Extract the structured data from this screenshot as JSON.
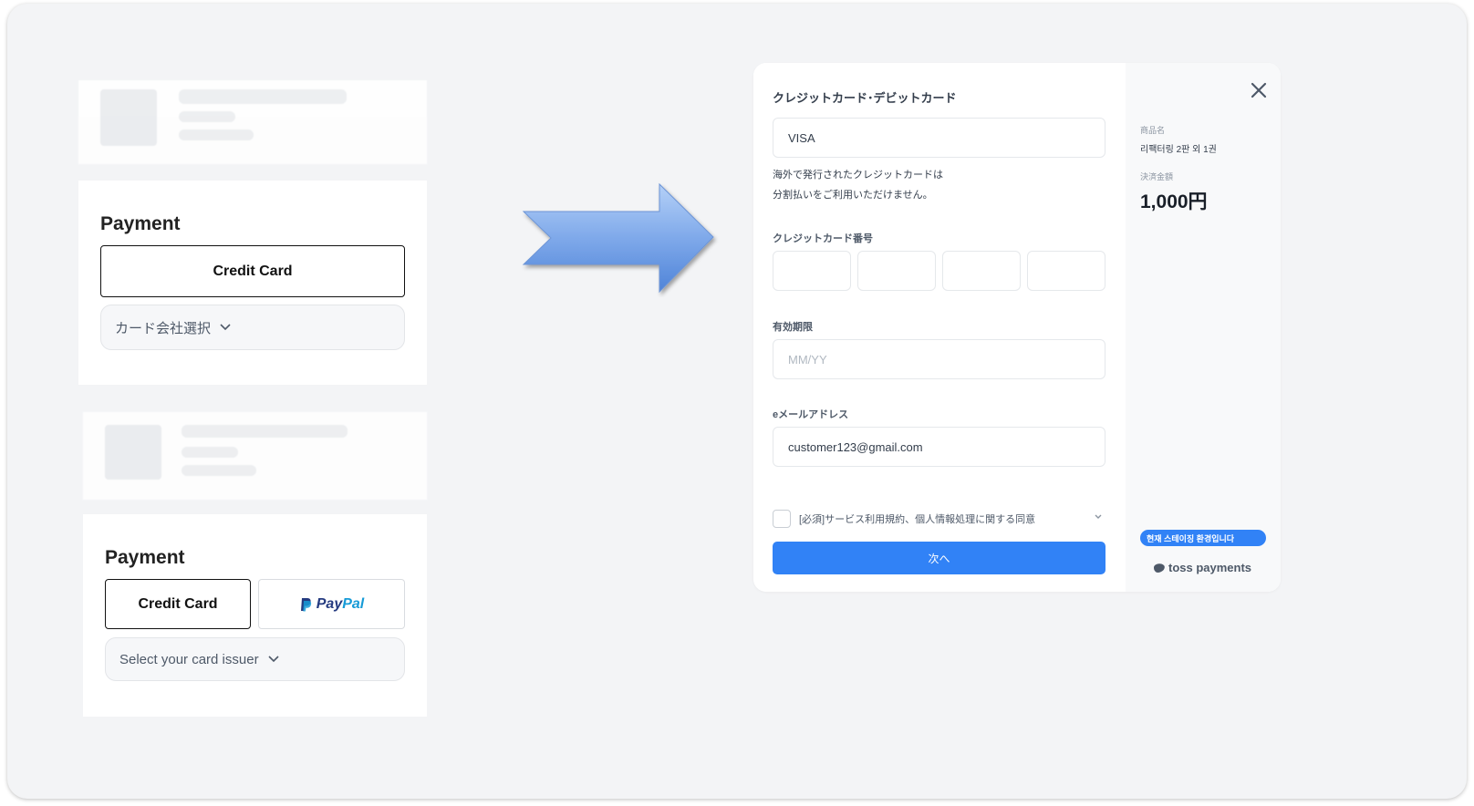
{
  "before_upper": {
    "payment_title": "Payment",
    "credit_card_label": "Credit Card",
    "issuer_select": "カード会社選択"
  },
  "before_lower": {
    "payment_title": "Payment",
    "credit_card_label": "Credit Card",
    "paypal_part1": "Pay",
    "paypal_part2": "Pal",
    "issuer_select": "Select your card issuer"
  },
  "checkout": {
    "heading": "クレジットカード･デビットカード",
    "card_brand_value": "VISA",
    "overseas_note_line1": "海外で発行されたクレジットカードは",
    "overseas_note_line2": "分割払いをご利用いただけません。",
    "card_number_label": "クレジットカード番号",
    "expiry_label": "有効期限",
    "expiry_placeholder": "MM/YY",
    "email_label": "eメールアドレス",
    "email_value": "customer123@gmail.com",
    "agree_text": "[必須]サービス利用規約、個人情報処理に関する同意",
    "next_button": "次へ",
    "side": {
      "product_label": "商品名",
      "product_value": "리팩터링 2판 외 1권",
      "amount_label": "決済金額",
      "amount_value": "1,000円",
      "stage_badge": "현재 스테이징 환경입니다",
      "brand": "toss payments"
    }
  },
  "colors": {
    "primary_blue": "#3182f6",
    "arrow_light": "#a9c8f5",
    "arrow_dark": "#4a7fd4",
    "paypal_dark": "#253b80",
    "paypal_light": "#179bd7"
  }
}
